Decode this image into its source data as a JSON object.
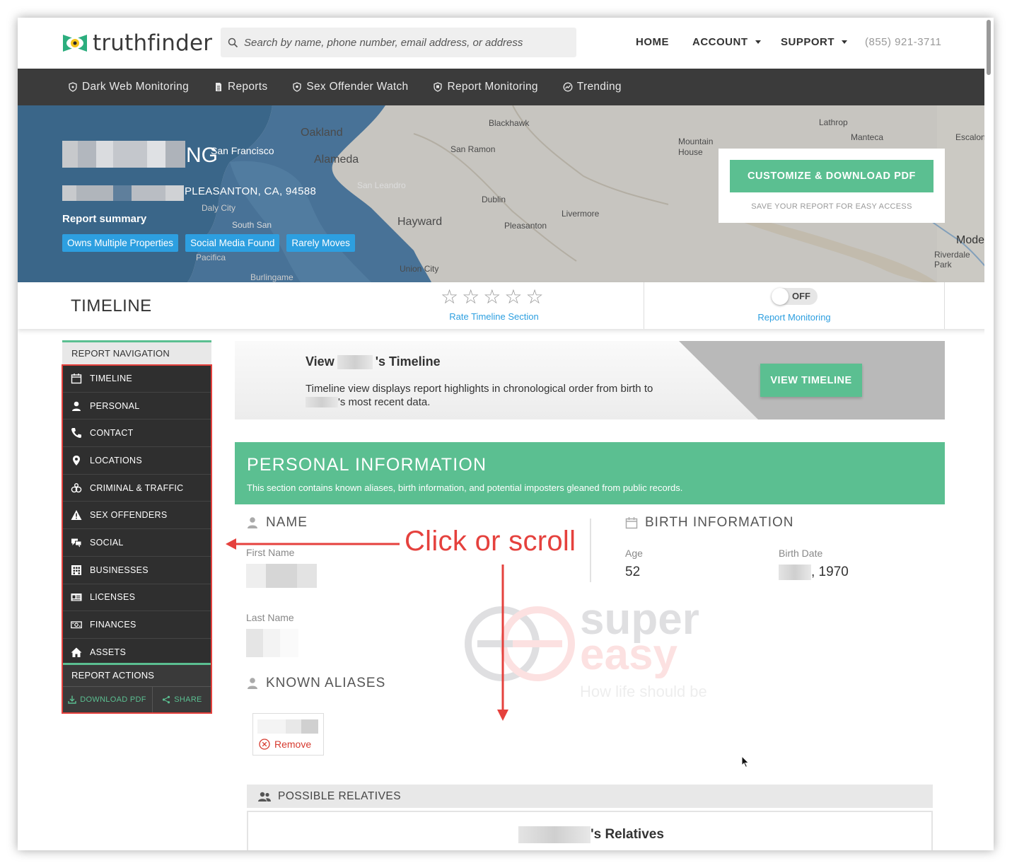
{
  "header": {
    "logo_text": "truthfinder",
    "search_placeholder": "Search by name, phone number, email address, or address",
    "nav": [
      "HOME",
      "ACCOUNT",
      "SUPPORT"
    ],
    "phone": "(855) 921-3711"
  },
  "subnav": [
    "Dark Web Monitoring",
    "Reports",
    "Sex Offender Watch",
    "Report Monitoring",
    "Trending"
  ],
  "hero": {
    "name_suffix": "NG",
    "address": "PLEASANTON, CA, 94588",
    "summary_label": "Report summary",
    "badges": [
      "Owns Multiple Properties",
      "Social Media Found",
      "Rarely Moves"
    ],
    "pdf_button": "CUSTOMIZE & DOWNLOAD PDF",
    "pdf_note": "SAVE YOUR REPORT FOR EASY ACCESS",
    "map_labels": [
      "Oakland",
      "San Francisco",
      "Alameda",
      "Blackhawk",
      "San Ramon",
      "Lathrop",
      "Manteca",
      "Mountain House",
      "Escalon",
      "San Leandro",
      "Daly City",
      "Dublin",
      "Livermore",
      "South San",
      "Hayward",
      "Pleasanton",
      "Pacifica",
      "Union City",
      "Burlingame",
      "Modest",
      "Riverdale Park"
    ]
  },
  "timeline_bar": {
    "title": "TIMELINE",
    "rate_label": "Rate Timeline Section",
    "toggle_state": "OFF",
    "monitoring_label": "Report Monitoring"
  },
  "report_nav": {
    "heading": "REPORT NAVIGATION",
    "items": [
      "TIMELINE",
      "PERSONAL",
      "CONTACT",
      "LOCATIONS",
      "CRIMINAL & TRAFFIC",
      "SEX OFFENDERS",
      "SOCIAL",
      "BUSINESSES",
      "LICENSES",
      "FINANCES",
      "ASSETS"
    ],
    "actions_heading": "REPORT ACTIONS",
    "download": "DOWNLOAD PDF",
    "share": "SHARE"
  },
  "promo": {
    "title_prefix": "View",
    "title_suffix": "'s Timeline",
    "text_line1": "Timeline view displays report highlights in chronological order from birth to",
    "text_line2": "'s most recent data.",
    "button": "VIEW TIMELINE"
  },
  "personal": {
    "title": "PERSONAL INFORMATION",
    "subtitle": "This section contains known aliases, birth information, and potential imposters gleaned from public records.",
    "name_heading": "NAME",
    "first_name_label": "First Name",
    "last_name_label": "Last Name",
    "birth_heading": "BIRTH INFORMATION",
    "age_label": "Age",
    "age": "52",
    "birth_date_label": "Birth Date",
    "birth_date_year": ", 1970",
    "aliases_heading": "KNOWN ALIASES",
    "remove": "Remove",
    "relatives_heading": "POSSIBLE RELATIVES",
    "relatives_title_suffix": "'s Relatives"
  },
  "annotation": "Click or scroll",
  "watermark": {
    "line1": "super",
    "line2": "easy",
    "tagline": "How life should be"
  },
  "colors": {
    "brand_green": "#5bbf91",
    "badge_blue": "#2d9fe0",
    "nav_dark": "#3b3b3b",
    "annotation_red": "#e5413d"
  }
}
